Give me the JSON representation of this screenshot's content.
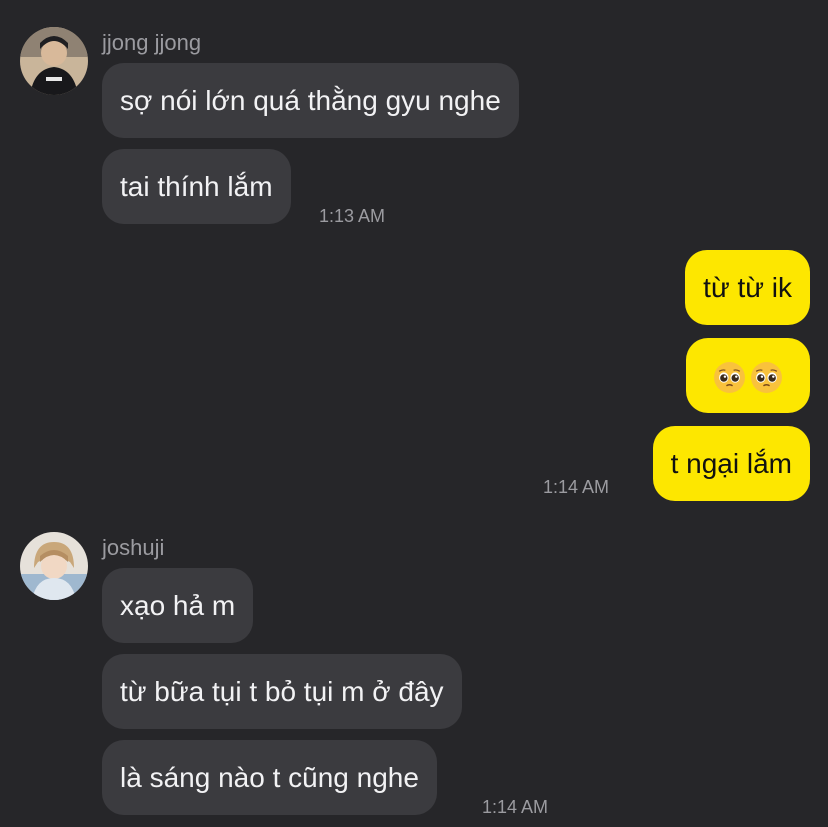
{
  "groups": [
    {
      "sender": "jjong jjong",
      "messages": [
        "sợ nói lớn quá thằng gyu nghe",
        "tai thính lắm"
      ],
      "time": "1:13 AM"
    },
    {
      "sender": "me",
      "messages": [
        "từ từ ik",
        "🥺🥺",
        "t ngại lắm"
      ],
      "time": "1:14 AM"
    },
    {
      "sender": "joshuji",
      "messages": [
        "xạo hả m",
        "từ bữa tụi t bỏ tụi m ở đây",
        "là sáng nào t cũng nghe"
      ],
      "time": "1:14 AM"
    }
  ],
  "colors": {
    "background": "#262629",
    "incoming_bubble": "#3b3b3f",
    "outgoing_bubble": "#fde700",
    "secondary_text": "#9b9ba0"
  },
  "icons": [
    "pleading-face-emoji",
    "pleading-face-emoji"
  ]
}
